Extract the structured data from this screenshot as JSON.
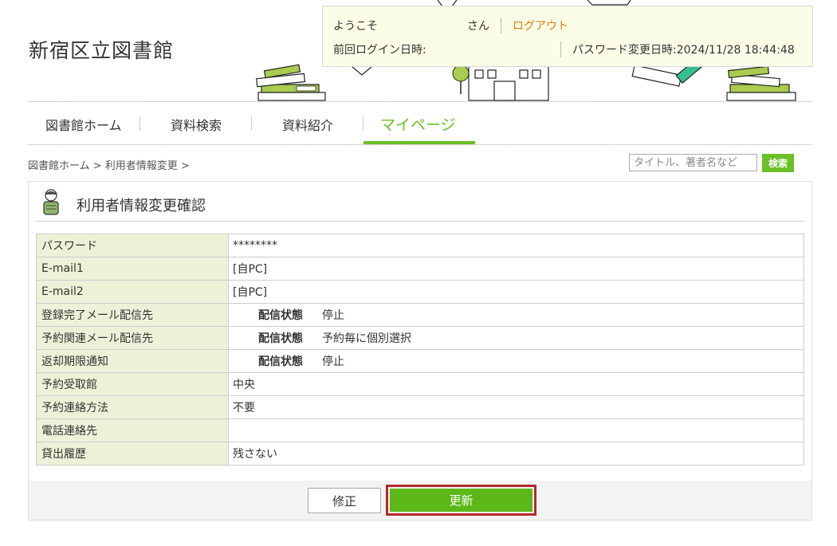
{
  "header": {
    "site_title": "新宿区立図書館"
  },
  "userbox": {
    "welcome": "ようこそ",
    "san": "さん",
    "logout": "ログアウト",
    "last_login_label": "前回ログイン日時:",
    "password_change": "パスワード変更日時:2024/11/28 18:44:48"
  },
  "nav": {
    "items": [
      {
        "label": "図書館ホーム"
      },
      {
        "label": "資料検索"
      },
      {
        "label": "資料紹介"
      },
      {
        "label": "マイページ"
      }
    ]
  },
  "breadcrumb": {
    "home": "図書館ホーム",
    "sep1": " > ",
    "current": "利用者情報変更",
    "sep2": " >"
  },
  "search": {
    "placeholder": "タイトル、著者名など",
    "button": "検索"
  },
  "panel": {
    "title": "利用者情報変更確認",
    "rows": [
      {
        "label": "パスワード",
        "value": "********"
      },
      {
        "label": "E-mail1",
        "value": "[自PC]"
      },
      {
        "label": "E-mail2",
        "value": "[自PC]"
      },
      {
        "label": "登録完了メール配信先",
        "sub_label": "配信状態",
        "value": "停止"
      },
      {
        "label": "予約関連メール配信先",
        "sub_label": "配信状態",
        "value": "予約毎に個別選択"
      },
      {
        "label": "返却期限通知",
        "sub_label": "配信状態",
        "value": "停止"
      },
      {
        "label": "予約受取館",
        "value": "中央"
      },
      {
        "label": "予約連絡方法",
        "value": "不要"
      },
      {
        "label": "電話連絡先",
        "value": ""
      },
      {
        "label": "貸出履歴",
        "value": "残さない"
      }
    ],
    "edit_button": "修正",
    "update_button": "更新"
  },
  "colors": {
    "accent": "#6bbf27",
    "logout": "#e07b10",
    "label_bg": "#eef1d8",
    "userbox_bg": "#fbfde6",
    "highlight_border": "#b42a2a"
  }
}
